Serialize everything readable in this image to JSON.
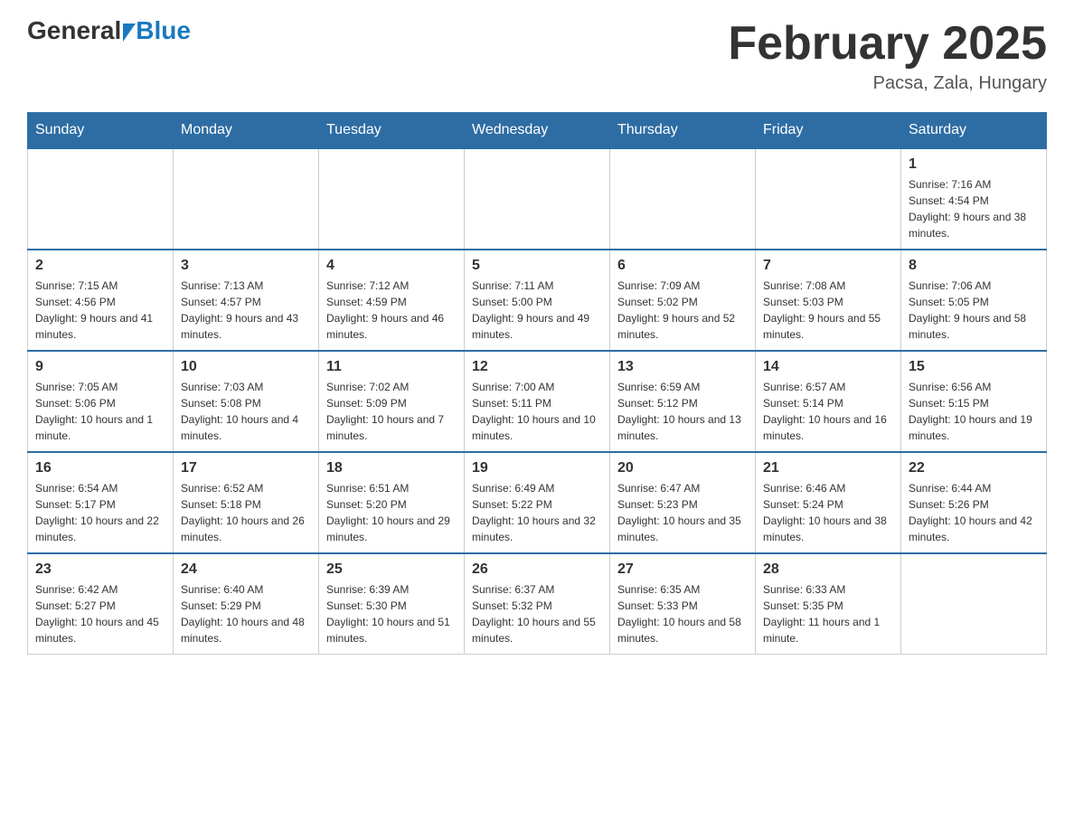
{
  "logo": {
    "general": "General",
    "blue": "Blue"
  },
  "title": "February 2025",
  "location": "Pacsa, Zala, Hungary",
  "days_of_week": [
    "Sunday",
    "Monday",
    "Tuesday",
    "Wednesday",
    "Thursday",
    "Friday",
    "Saturday"
  ],
  "weeks": [
    [
      {
        "day": "",
        "sunrise": "",
        "sunset": "",
        "daylight": ""
      },
      {
        "day": "",
        "sunrise": "",
        "sunset": "",
        "daylight": ""
      },
      {
        "day": "",
        "sunrise": "",
        "sunset": "",
        "daylight": ""
      },
      {
        "day": "",
        "sunrise": "",
        "sunset": "",
        "daylight": ""
      },
      {
        "day": "",
        "sunrise": "",
        "sunset": "",
        "daylight": ""
      },
      {
        "day": "",
        "sunrise": "",
        "sunset": "",
        "daylight": ""
      },
      {
        "day": "1",
        "sunrise": "Sunrise: 7:16 AM",
        "sunset": "Sunset: 4:54 PM",
        "daylight": "Daylight: 9 hours and 38 minutes."
      }
    ],
    [
      {
        "day": "2",
        "sunrise": "Sunrise: 7:15 AM",
        "sunset": "Sunset: 4:56 PM",
        "daylight": "Daylight: 9 hours and 41 minutes."
      },
      {
        "day": "3",
        "sunrise": "Sunrise: 7:13 AM",
        "sunset": "Sunset: 4:57 PM",
        "daylight": "Daylight: 9 hours and 43 minutes."
      },
      {
        "day": "4",
        "sunrise": "Sunrise: 7:12 AM",
        "sunset": "Sunset: 4:59 PM",
        "daylight": "Daylight: 9 hours and 46 minutes."
      },
      {
        "day": "5",
        "sunrise": "Sunrise: 7:11 AM",
        "sunset": "Sunset: 5:00 PM",
        "daylight": "Daylight: 9 hours and 49 minutes."
      },
      {
        "day": "6",
        "sunrise": "Sunrise: 7:09 AM",
        "sunset": "Sunset: 5:02 PM",
        "daylight": "Daylight: 9 hours and 52 minutes."
      },
      {
        "day": "7",
        "sunrise": "Sunrise: 7:08 AM",
        "sunset": "Sunset: 5:03 PM",
        "daylight": "Daylight: 9 hours and 55 minutes."
      },
      {
        "day": "8",
        "sunrise": "Sunrise: 7:06 AM",
        "sunset": "Sunset: 5:05 PM",
        "daylight": "Daylight: 9 hours and 58 minutes."
      }
    ],
    [
      {
        "day": "9",
        "sunrise": "Sunrise: 7:05 AM",
        "sunset": "Sunset: 5:06 PM",
        "daylight": "Daylight: 10 hours and 1 minute."
      },
      {
        "day": "10",
        "sunrise": "Sunrise: 7:03 AM",
        "sunset": "Sunset: 5:08 PM",
        "daylight": "Daylight: 10 hours and 4 minutes."
      },
      {
        "day": "11",
        "sunrise": "Sunrise: 7:02 AM",
        "sunset": "Sunset: 5:09 PM",
        "daylight": "Daylight: 10 hours and 7 minutes."
      },
      {
        "day": "12",
        "sunrise": "Sunrise: 7:00 AM",
        "sunset": "Sunset: 5:11 PM",
        "daylight": "Daylight: 10 hours and 10 minutes."
      },
      {
        "day": "13",
        "sunrise": "Sunrise: 6:59 AM",
        "sunset": "Sunset: 5:12 PM",
        "daylight": "Daylight: 10 hours and 13 minutes."
      },
      {
        "day": "14",
        "sunrise": "Sunrise: 6:57 AM",
        "sunset": "Sunset: 5:14 PM",
        "daylight": "Daylight: 10 hours and 16 minutes."
      },
      {
        "day": "15",
        "sunrise": "Sunrise: 6:56 AM",
        "sunset": "Sunset: 5:15 PM",
        "daylight": "Daylight: 10 hours and 19 minutes."
      }
    ],
    [
      {
        "day": "16",
        "sunrise": "Sunrise: 6:54 AM",
        "sunset": "Sunset: 5:17 PM",
        "daylight": "Daylight: 10 hours and 22 minutes."
      },
      {
        "day": "17",
        "sunrise": "Sunrise: 6:52 AM",
        "sunset": "Sunset: 5:18 PM",
        "daylight": "Daylight: 10 hours and 26 minutes."
      },
      {
        "day": "18",
        "sunrise": "Sunrise: 6:51 AM",
        "sunset": "Sunset: 5:20 PM",
        "daylight": "Daylight: 10 hours and 29 minutes."
      },
      {
        "day": "19",
        "sunrise": "Sunrise: 6:49 AM",
        "sunset": "Sunset: 5:22 PM",
        "daylight": "Daylight: 10 hours and 32 minutes."
      },
      {
        "day": "20",
        "sunrise": "Sunrise: 6:47 AM",
        "sunset": "Sunset: 5:23 PM",
        "daylight": "Daylight: 10 hours and 35 minutes."
      },
      {
        "day": "21",
        "sunrise": "Sunrise: 6:46 AM",
        "sunset": "Sunset: 5:24 PM",
        "daylight": "Daylight: 10 hours and 38 minutes."
      },
      {
        "day": "22",
        "sunrise": "Sunrise: 6:44 AM",
        "sunset": "Sunset: 5:26 PM",
        "daylight": "Daylight: 10 hours and 42 minutes."
      }
    ],
    [
      {
        "day": "23",
        "sunrise": "Sunrise: 6:42 AM",
        "sunset": "Sunset: 5:27 PM",
        "daylight": "Daylight: 10 hours and 45 minutes."
      },
      {
        "day": "24",
        "sunrise": "Sunrise: 6:40 AM",
        "sunset": "Sunset: 5:29 PM",
        "daylight": "Daylight: 10 hours and 48 minutes."
      },
      {
        "day": "25",
        "sunrise": "Sunrise: 6:39 AM",
        "sunset": "Sunset: 5:30 PM",
        "daylight": "Daylight: 10 hours and 51 minutes."
      },
      {
        "day": "26",
        "sunrise": "Sunrise: 6:37 AM",
        "sunset": "Sunset: 5:32 PM",
        "daylight": "Daylight: 10 hours and 55 minutes."
      },
      {
        "day": "27",
        "sunrise": "Sunrise: 6:35 AM",
        "sunset": "Sunset: 5:33 PM",
        "daylight": "Daylight: 10 hours and 58 minutes."
      },
      {
        "day": "28",
        "sunrise": "Sunrise: 6:33 AM",
        "sunset": "Sunset: 5:35 PM",
        "daylight": "Daylight: 11 hours and 1 minute."
      },
      {
        "day": "",
        "sunrise": "",
        "sunset": "",
        "daylight": ""
      }
    ]
  ]
}
